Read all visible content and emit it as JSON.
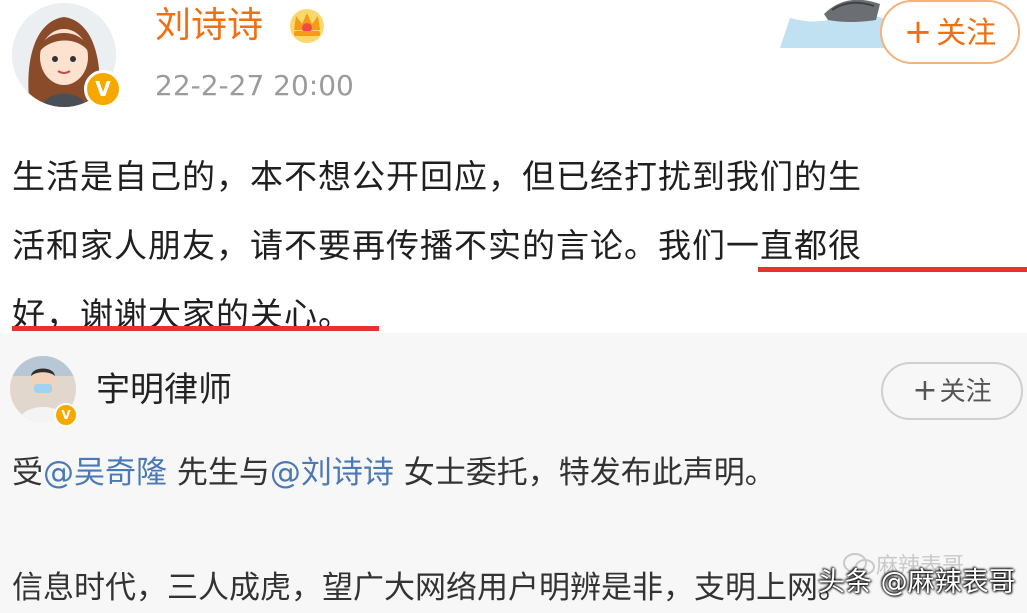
{
  "post": {
    "author": "刘诗诗",
    "timestamp": "22-2-27 20:00",
    "follow_label": "关注",
    "follow_plus": "+",
    "badge": "V",
    "lines": [
      "生活是自己的，本不想公开回应，但已经打扰到我们的生",
      "活和家人朋友，请不要再传播不实的言论。我们一直都很",
      "好，谢谢大家的关心。"
    ]
  },
  "quoted": {
    "author": "宇明律师",
    "follow_label": "关注",
    "follow_plus": "+",
    "badge": "V",
    "line1": {
      "p1": "受",
      "m1": "@吴奇隆",
      "p2": " 先生与",
      "m2": "@刘诗诗",
      "p3": " 女士委托，特发布此声明。"
    },
    "line2": "信息时代，三人成虎，望广大网络用户明辨是非，支明上网。"
  },
  "watermark": {
    "faded": "麻辣表哥",
    "main": "头条 @麻辣表哥"
  },
  "colors": {
    "name_orange": "#f26e0e",
    "highlight_red": "#e8332c",
    "mention_blue": "#4a79b5",
    "verified_gold": "#f6a800"
  },
  "icons": [
    "verified-badge-icon",
    "crown-icon",
    "boat-icon",
    "wechat-icon"
  ]
}
